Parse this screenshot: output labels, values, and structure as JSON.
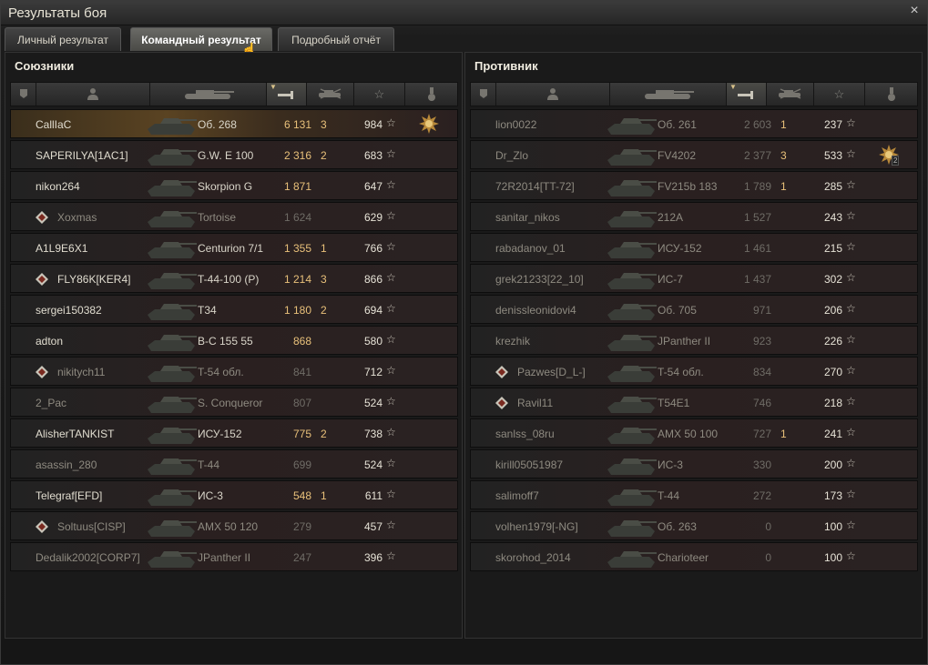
{
  "window": {
    "title": "Результаты боя",
    "close_icon": "×"
  },
  "tabs": [
    {
      "label": "Личный результат"
    },
    {
      "label": "Командный результат"
    },
    {
      "label": "Подробный отчёт"
    }
  ],
  "allies": {
    "title": "Союзники",
    "rows": [
      {
        "name": "CallIaC",
        "tank": "Об. 268",
        "damage": "6 131",
        "kills": "3",
        "xp": "984",
        "self": true,
        "medal": true
      },
      {
        "name": "SAPERILYA[1AC1]",
        "tank": "G.W. E 100",
        "damage": "2 316",
        "kills": "2",
        "xp": "683"
      },
      {
        "name": "nikon264",
        "tank": "Skorpion G",
        "damage": "1 871",
        "kills": "",
        "xp": "647"
      },
      {
        "name": "Xoxmas",
        "tank": "Tortoise",
        "damage": "1 624",
        "kills": "",
        "xp": "629",
        "dead": true,
        "platoon": true
      },
      {
        "name": "A1L9E6X1",
        "tank": "Centurion 7/1",
        "damage": "1 355",
        "kills": "1",
        "xp": "766"
      },
      {
        "name": "FLY86K[KER4]",
        "tank": "T-44-100 (P)",
        "damage": "1 214",
        "kills": "3",
        "xp": "866",
        "platoon": true
      },
      {
        "name": "sergei150382",
        "tank": "T34",
        "damage": "1 180",
        "kills": "2",
        "xp": "694"
      },
      {
        "name": "adton",
        "tank": "B-C 155 55",
        "damage": "868",
        "kills": "",
        "xp": "580"
      },
      {
        "name": "nikitych11",
        "tank": "T-54 обл.",
        "damage": "841",
        "kills": "",
        "xp": "712",
        "dead": true,
        "platoon": true
      },
      {
        "name": "2_Pac",
        "tank": "S. Conqueror",
        "damage": "807",
        "kills": "",
        "xp": "524",
        "dead": true
      },
      {
        "name": "AlisherTANKIST",
        "tank": "ИСУ-152",
        "damage": "775",
        "kills": "2",
        "xp": "738"
      },
      {
        "name": "asassin_280",
        "tank": "T-44",
        "damage": "699",
        "kills": "",
        "xp": "524",
        "dead": true
      },
      {
        "name": "Telegraf[EFD]",
        "tank": "ИС-3",
        "damage": "548",
        "kills": "1",
        "xp": "611"
      },
      {
        "name": "Soltuus[CISP]",
        "tank": "AMX 50 120",
        "damage": "279",
        "kills": "",
        "xp": "457",
        "dead": true,
        "platoon": true
      },
      {
        "name": "Dedalik2002[CORP7]",
        "tank": "JPanther II",
        "damage": "247",
        "kills": "",
        "xp": "396",
        "dead": true
      }
    ]
  },
  "enemies": {
    "title": "Противник",
    "rows": [
      {
        "name": "lion0022",
        "tank": "Об. 261",
        "damage": "2 603",
        "kills": "1",
        "xp": "237",
        "dead": true
      },
      {
        "name": "Dr_Zlo",
        "tank": "FV4202",
        "damage": "2 377",
        "kills": "3",
        "xp": "533",
        "dead": true,
        "medal": true,
        "medal_count": "2"
      },
      {
        "name": "72R2014[TT-72]",
        "tank": "FV215b 183",
        "damage": "1 789",
        "kills": "1",
        "xp": "285",
        "dead": true
      },
      {
        "name": "sanitar_nikos",
        "tank": "212A",
        "damage": "1 527",
        "kills": "",
        "xp": "243",
        "dead": true
      },
      {
        "name": "rabadanov_01",
        "tank": "ИСУ-152",
        "damage": "1 461",
        "kills": "",
        "xp": "215",
        "dead": true
      },
      {
        "name": "grek21233[22_10]",
        "tank": "ИС-7",
        "damage": "1 437",
        "kills": "",
        "xp": "302",
        "dead": true
      },
      {
        "name": "denissleonidovi4",
        "tank": "Об. 705",
        "damage": "971",
        "kills": "",
        "xp": "206",
        "dead": true
      },
      {
        "name": "krezhik",
        "tank": "JPanther II",
        "damage": "923",
        "kills": "",
        "xp": "226",
        "dead": true
      },
      {
        "name": "Pazwes[D_L-]",
        "tank": "T-54 обл.",
        "damage": "834",
        "kills": "",
        "xp": "270",
        "dead": true,
        "platoon": true
      },
      {
        "name": "Ravil11",
        "tank": "T54E1",
        "damage": "746",
        "kills": "",
        "xp": "218",
        "dead": true,
        "platoon": true
      },
      {
        "name": "sanlss_08ru",
        "tank": "AMX 50 100",
        "damage": "727",
        "kills": "1",
        "xp": "241",
        "dead": true
      },
      {
        "name": "kirill05051987",
        "tank": "ИС-3",
        "damage": "330",
        "kills": "",
        "xp": "200",
        "dead": true
      },
      {
        "name": "salimoff7",
        "tank": "T-44",
        "damage": "272",
        "kills": "",
        "xp": "173",
        "dead": true
      },
      {
        "name": "volhen1979[-NG]",
        "tank": "Об. 263",
        "damage": "0",
        "kills": "",
        "xp": "100",
        "dead": true
      },
      {
        "name": "skorohod_2014",
        "tank": "Charioteer",
        "damage": "0",
        "kills": "",
        "xp": "100",
        "dead": true
      }
    ]
  },
  "icons": {
    "column_squad": "squad-icon",
    "column_player": "player-icon",
    "column_tank": "tank-icon",
    "column_damage": "damage-icon",
    "column_kills": "kills-icon",
    "column_xp": "xp-star-icon",
    "column_medal": "medal-icon"
  }
}
